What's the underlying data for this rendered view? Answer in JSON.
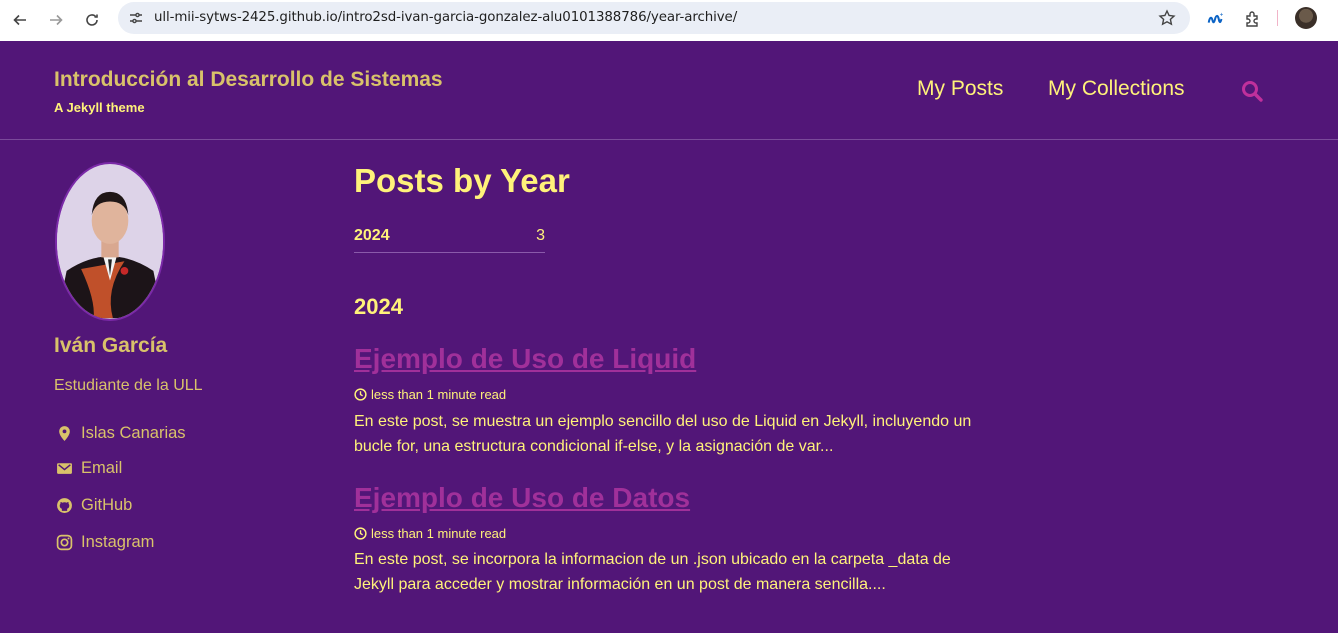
{
  "browser": {
    "url": "ull-mii-sytws-2425.github.io/intro2sd-ivan-garcia-gonzalez-alu0101388786/year-archive/"
  },
  "header": {
    "site_title": "Introducción al Desarrollo de Sistemas",
    "tagline": "A Jekyll theme",
    "nav": [
      {
        "label": "My Posts"
      },
      {
        "label": "My Collections"
      }
    ]
  },
  "sidebar": {
    "name": "Iván García",
    "bio": "Estudiante de la ULL",
    "links": [
      {
        "label": "Islas Canarias",
        "icon": "map-marker-icon"
      },
      {
        "label": "Email",
        "icon": "envelope-icon"
      },
      {
        "label": "GitHub",
        "icon": "github-icon"
      },
      {
        "label": "Instagram",
        "icon": "instagram-icon"
      }
    ]
  },
  "main": {
    "title": "Posts by Year",
    "year_table": [
      {
        "year": "2024",
        "count": "3"
      }
    ],
    "year_heading": "2024",
    "posts": [
      {
        "title": "Ejemplo de Uso de Liquid",
        "read_time": "less than 1 minute read",
        "excerpt": "En este post, se muestra un ejemplo sencillo del uso de Liquid en Jekyll, incluyendo un bucle for, una estructura condicional if-else, y la asignación de var..."
      },
      {
        "title": "Ejemplo de Uso de Datos",
        "read_time": "less than 1 minute read",
        "excerpt": "En este post, se incorpora la informacion de un .json ubicado en la carpeta _data de Jekyll para acceder y mostrar información en un post de manera sencilla...."
      }
    ]
  },
  "colors": {
    "background": "#521678",
    "accent_yellow": "#fff27a",
    "muted_gold": "#d9c26a",
    "link_magenta": "#a0309a"
  }
}
